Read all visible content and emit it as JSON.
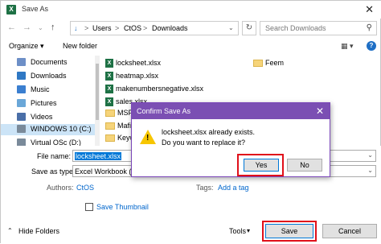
{
  "title": "Save As",
  "app_icon": "X",
  "nav": {
    "back": "←",
    "forward": "→",
    "up_arrow": "↓",
    "up": "↑",
    "path": [
      "Users",
      "CtOS",
      "Downloads"
    ],
    "sep": ">",
    "search_placeholder": "Search Downloads"
  },
  "toolbar": {
    "organize": "Organize ▾",
    "new_folder": "New folder",
    "view": "▦ ▾",
    "help": "?"
  },
  "sidebar": [
    {
      "label": "Documents",
      "icon": "documents-icon",
      "color": "#6d8fc7"
    },
    {
      "label": "Downloads",
      "icon": "downloads-icon",
      "color": "#2f78c4"
    },
    {
      "label": "Music",
      "icon": "music-icon",
      "color": "#3b7fd0"
    },
    {
      "label": "Pictures",
      "icon": "pictures-icon",
      "color": "#6aa7d8"
    },
    {
      "label": "Videos",
      "icon": "videos-icon",
      "color": "#4a6fa8"
    },
    {
      "label": "WINDOWS 10 (C:)",
      "icon": "drive-icon",
      "color": "#7a8a9a"
    },
    {
      "label": "Virtual OSc (D:)",
      "icon": "drive-icon",
      "color": "#7a8a9a"
    }
  ],
  "files": [
    {
      "name": "locksheet.xlsx",
      "type": "excel"
    },
    {
      "name": "heatmap.xlsx",
      "type": "excel"
    },
    {
      "name": "makenumbersnegative.xlsx",
      "type": "excel"
    },
    {
      "name": "sales.xlsx",
      "type": "excel"
    },
    {
      "name": "MSPI",
      "type": "folder"
    },
    {
      "name": "Mafia",
      "type": "folder"
    },
    {
      "name": "Keyw",
      "type": "folder"
    },
    {
      "name": "Feem",
      "type": "folder"
    }
  ],
  "form": {
    "file_name_label": "File name:",
    "file_name_value": "locksheet.xlsx",
    "save_type_label": "Save as type:",
    "save_type_value": "Excel Workbook (*.xlsx)",
    "authors_label": "Authors:",
    "authors_value": "CtOS",
    "tags_label": "Tags:",
    "tags_value": "Add a tag",
    "thumbnail_label": "Save Thumbnail"
  },
  "footer": {
    "hide_folders": "Hide Folders",
    "tools": "Tools",
    "save": "Save",
    "cancel": "Cancel"
  },
  "dialog": {
    "title": "Confirm Save As",
    "line1": "locksheet.xlsx already exists.",
    "line2": "Do you want to replace it?",
    "yes": "Yes",
    "no": "No"
  },
  "colors": {
    "dialog_title": "#7b4fb3",
    "highlight_box": "#e0101a",
    "selection": "#0078d7"
  }
}
